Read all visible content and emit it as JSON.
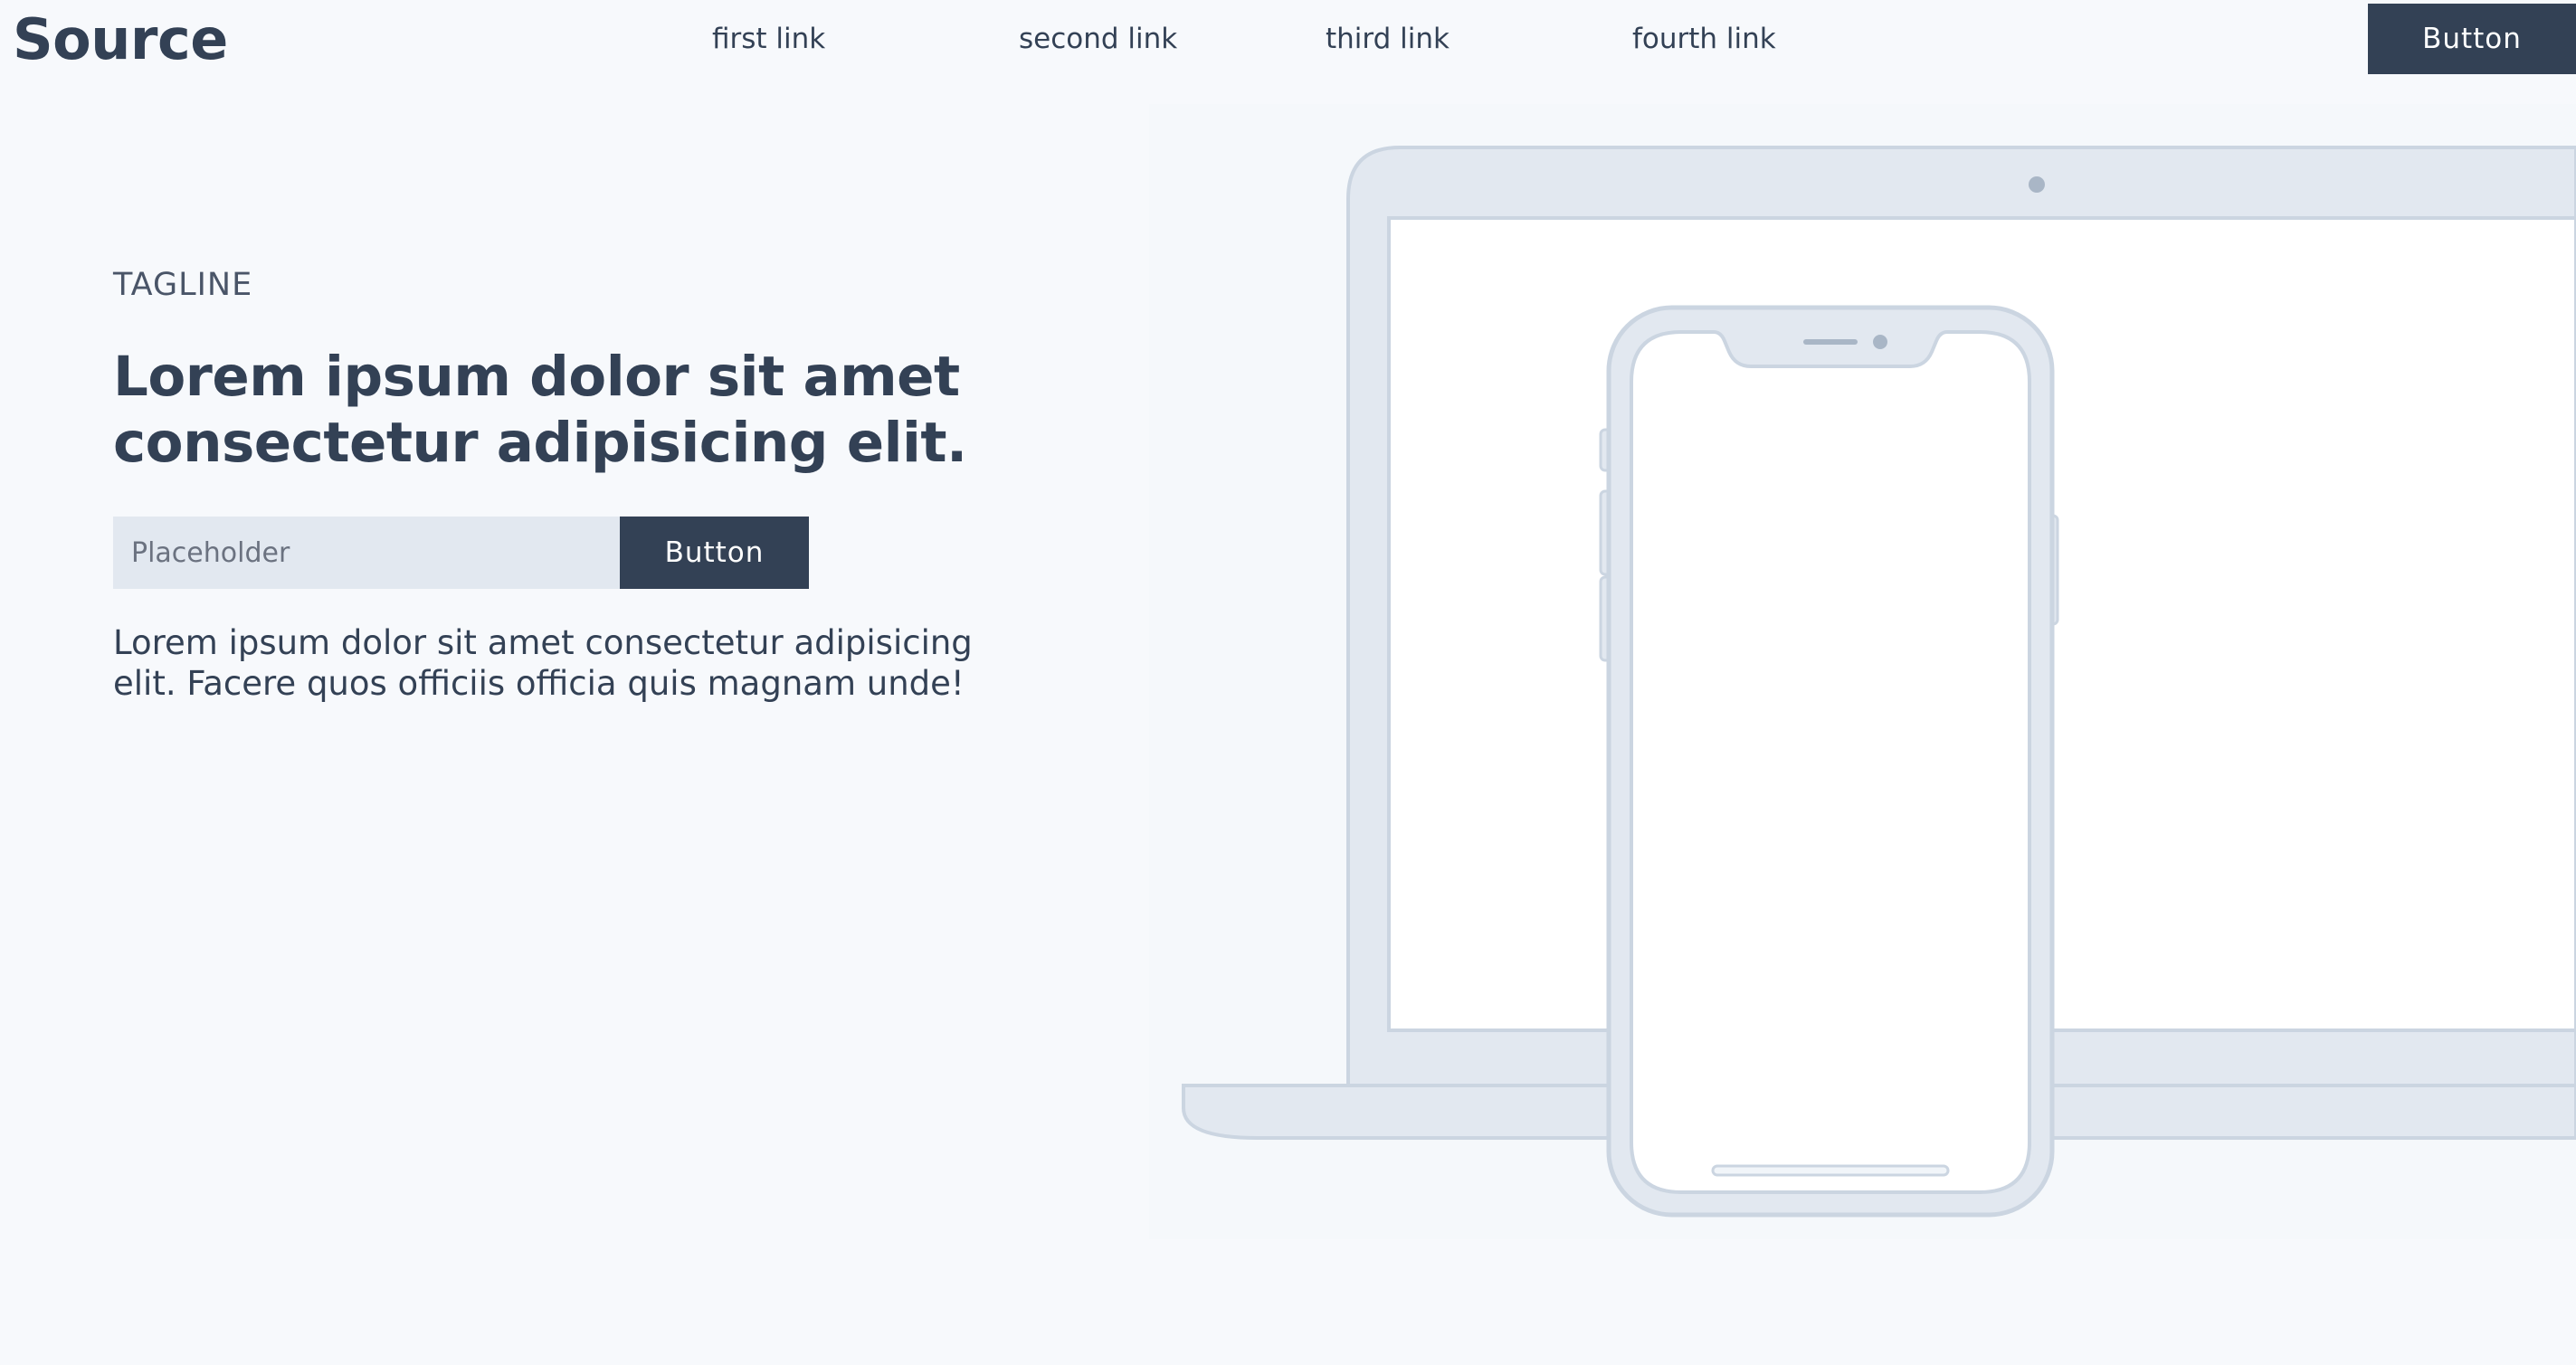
{
  "nav": {
    "brand": "Source",
    "links": [
      {
        "label": "first link"
      },
      {
        "label": "second link"
      },
      {
        "label": "third link"
      },
      {
        "label": "fourth link"
      }
    ],
    "cta_label": "Button"
  },
  "hero": {
    "tagline": "TAGLINE",
    "headline_line1": "Lorem ipsum dolor sit amet",
    "headline_line2": "consectetur adipisicing elit.",
    "input_placeholder": "Placeholder",
    "input_value": "",
    "button_label": "Button",
    "description_line1": "Lorem ipsum dolor sit amet consectetur adipisicing",
    "description_line2": "elit. Facere quos officiis officia quis magnam unde!"
  },
  "illustration": {
    "devices": [
      "laptop",
      "smartphone"
    ],
    "colors": {
      "device_fill": "#e2e8f0",
      "device_stroke": "#cbd5e1",
      "screen": "#ffffff",
      "background": "#f5f8fb"
    }
  },
  "colors": {
    "page_background": "#f7f9fc",
    "primary": "#334155",
    "input_background": "#e2e8f0",
    "button_text": "#ffffff"
  }
}
